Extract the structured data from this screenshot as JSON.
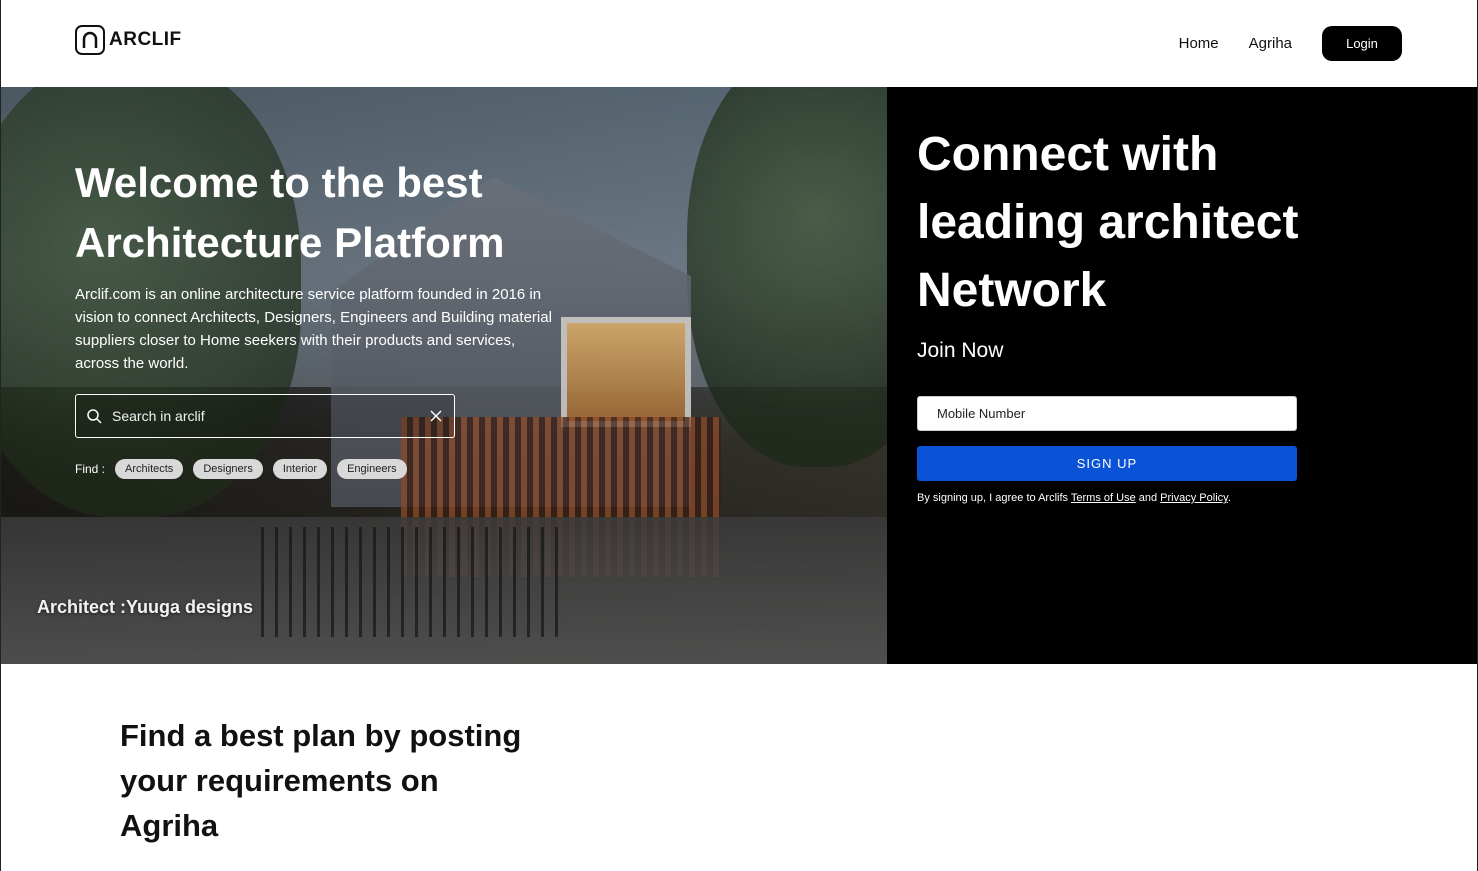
{
  "header": {
    "logo_text": "ARCLIF",
    "nav": [
      {
        "label": "Home"
      },
      {
        "label": "Agriha"
      }
    ],
    "login_label": "Login"
  },
  "hero": {
    "title": "Welcome to the best Architecture Platform",
    "description": "Arclif.com is an online architecture service platform founded in 2016 in vision to connect Architects, Designers, Engineers and Building material suppliers closer to Home seekers with their products and services, across the world.",
    "search_placeholder": "Search in arclif",
    "find_label": "Find :",
    "chips": [
      "Architects",
      "Designers",
      "Interior",
      "Engineers"
    ],
    "credit": "Architect :Yuuga designs"
  },
  "signup_panel": {
    "title": "Connect with leading architect Network",
    "join_label": "Join Now",
    "mobile_placeholder": "Mobile Number",
    "signup_label": "SIGN UP",
    "agree_prefix": "By signing up, I agree to Arclifs",
    "terms_label": "Terms of Use",
    "and_text": "and",
    "privacy_label": "Privacy Policy",
    "period": ".",
    "accent_color": "#0a53d6"
  },
  "plan_section": {
    "title": "Find a best plan by posting your requirements on Agriha"
  }
}
